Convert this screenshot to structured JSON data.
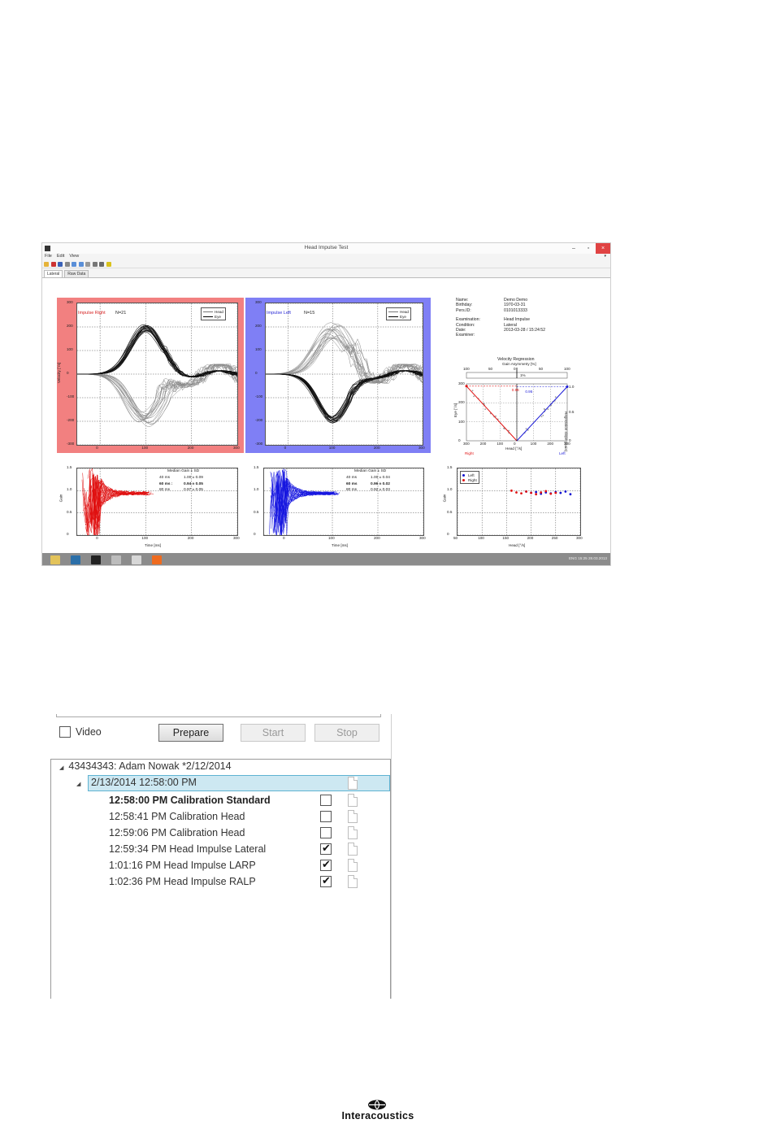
{
  "window": {
    "title": "Head Impulse Test",
    "menu": [
      "File",
      "Edit",
      "View"
    ],
    "tabs": [
      "Lateral",
      "Raw Data"
    ],
    "controls": {
      "minimize": "–",
      "maximize": "▫",
      "close": "×"
    }
  },
  "patient_info": [
    {
      "label": "Name:",
      "value": "Demo Demo"
    },
    {
      "label": "Birthday:",
      "value": "1970-03-31"
    },
    {
      "label": "Pers.ID:",
      "value": "0101013333"
    },
    {
      "label": "Examination:",
      "value": "Head Impulse"
    },
    {
      "label": "Condition:",
      "value": "Lateral"
    },
    {
      "label": "Date:",
      "value": "2013-03-28 / 15:24:52"
    },
    {
      "label": "Examiner:",
      "value": ""
    }
  ],
  "impulse_right": {
    "title": "Impulse Right",
    "count": "N=21",
    "ylabel": "Velocity [°/s]",
    "yticks": [
      "300",
      "200",
      "100",
      "0",
      "-100",
      "-200",
      "-300"
    ],
    "xticks": [
      "0",
      "100",
      "200",
      "300"
    ],
    "legend": [
      "Head",
      "Eye"
    ],
    "color": "#f28080"
  },
  "impulse_left": {
    "title": "Impulse Left",
    "count": "N=15",
    "yticks": [
      "300",
      "200",
      "100",
      "0",
      "-100",
      "-200",
      "-300"
    ],
    "xticks": [
      "0",
      "100",
      "200",
      "300"
    ],
    "legend": [
      "Head",
      "Eye"
    ],
    "color": "#7f7ff5"
  },
  "gain_right": {
    "ylabel": "Gain",
    "xlabel": "Time [ms]",
    "yticks": [
      "1.5",
      "1.0",
      "0.5",
      "0"
    ],
    "xticks": [
      "0",
      "100",
      "200",
      "300"
    ],
    "stats_header": "Median Gain ± SD",
    "stats": [
      {
        "k": "40 ms",
        "v": "1.00 ± 0.09",
        "bold": false
      },
      {
        "k": "60 ms :",
        "v": "0.94 ± 0.05",
        "bold": true
      },
      {
        "k": "80 ms",
        "v": "0.97 ± 0.05",
        "bold": false
      }
    ]
  },
  "gain_left": {
    "xlabel": "Time [ms]",
    "yticks": [
      "1.5",
      "1.0",
      "0.5",
      "0"
    ],
    "xticks": [
      "0",
      "100",
      "200",
      "300"
    ],
    "stats_header": "Median Gain ± SD",
    "stats": [
      {
        "k": "40 ms",
        "v": "1.00 ± 0.04",
        "bold": false
      },
      {
        "k": "60 ms",
        "v": "0.96 ± 0.02",
        "bold": true
      },
      {
        "k": "80 ms",
        "v": "0.92 ± 0.03",
        "bold": false
      }
    ]
  },
  "velocity_regression": {
    "title": "Velocity Regression",
    "top_axis_label": "Gain Asymmetry [%]",
    "top_ticks": [
      "100",
      "50",
      "0",
      "50",
      "100"
    ],
    "asym_value": "1%",
    "ylabel": "Eye [°/s]",
    "yticks": [
      "300",
      "200",
      "100",
      "0"
    ],
    "right_label": "Regression slope (Gain)",
    "right_ticks": [
      "1.0",
      "0.5",
      "0"
    ],
    "xlabel": "Head [°/s]",
    "xticks": [
      "300",
      "200",
      "100",
      "0",
      "100",
      "200",
      "300"
    ],
    "gain_right_value": "0.96",
    "gain_left_value": "0.95",
    "side_right": "Right",
    "side_left": "Left"
  },
  "gain_scatter": {
    "ylabel": "Gain",
    "xlabel": "Head [°/s]",
    "yticks": [
      "1.5",
      "1.0",
      "0.5",
      "0"
    ],
    "xticks": [
      "50",
      "100",
      "150",
      "200",
      "250",
      "300"
    ],
    "legend": [
      "Left",
      "Right"
    ]
  },
  "taskbar": {
    "tray": "ENG",
    "time": "15:25",
    "date": "28.03.2013"
  },
  "recording_panel": {
    "video_label": "Video",
    "prepare": "Prepare",
    "start": "Start",
    "stop": "Stop",
    "patient": "43434343: Adam Nowak *2/12/2014",
    "session": "2/13/2014 12:58:00 PM",
    "records": [
      {
        "label": "12:58:00 PM Calibration Standard",
        "checked": false,
        "bold": true
      },
      {
        "label": "12:58:41 PM Calibration Head",
        "checked": false,
        "bold": false
      },
      {
        "label": "12:59:06 PM Calibration Head",
        "checked": false,
        "bold": false
      },
      {
        "label": "12:59:34 PM Head Impulse Lateral",
        "checked": true,
        "bold": false
      },
      {
        "label": "1:01:16 PM Head Impulse LARP",
        "checked": true,
        "bold": false
      },
      {
        "label": "1:02:36 PM Head Impulse RALP",
        "checked": true,
        "bold": false
      }
    ]
  },
  "brand": {
    "name": "Interacoustics"
  },
  "chart_data": [
    {
      "type": "line",
      "title": "Impulse Right",
      "ylabel": "Velocity [°/s]",
      "xlim": [
        -50,
        300
      ],
      "ylim": [
        -300,
        300
      ],
      "series": [
        {
          "name": "Head",
          "x": [
            -50,
            0,
            50,
            100,
            150,
            200,
            250,
            300
          ],
          "values": [
            0,
            5,
            120,
            200,
            100,
            -30,
            -50,
            -40
          ]
        },
        {
          "name": "Eye",
          "x": [
            -50,
            0,
            50,
            100,
            150,
            200,
            250,
            300
          ],
          "values": [
            0,
            0,
            -70,
            -190,
            -100,
            20,
            30,
            0
          ]
        }
      ]
    },
    {
      "type": "line",
      "title": "Impulse Left",
      "xlim": [
        -50,
        300
      ],
      "ylim": [
        -300,
        300
      ],
      "series": [
        {
          "name": "Head",
          "x": [
            -50,
            0,
            50,
            100,
            150,
            200,
            250,
            300
          ],
          "values": [
            0,
            -5,
            -120,
            -210,
            -120,
            20,
            30,
            20
          ]
        },
        {
          "name": "Eye",
          "x": [
            -50,
            0,
            50,
            100,
            150,
            200,
            250,
            300
          ],
          "values": [
            0,
            0,
            120,
            230,
            120,
            -10,
            -20,
            0
          ]
        }
      ]
    },
    {
      "type": "line",
      "xlabel": "Time [ms]",
      "ylabel": "Gain",
      "xlim": [
        -50,
        300
      ],
      "ylim": [
        0,
        1.5
      ],
      "stats": {
        "40 ms": "1.00 ± 0.09",
        "60 ms": "0.94 ± 0.05",
        "80 ms": "0.97 ± 0.05"
      }
    },
    {
      "type": "line",
      "xlabel": "Time [ms]",
      "xlim": [
        -50,
        300
      ],
      "ylim": [
        0,
        1.5
      ],
      "stats": {
        "40 ms": "1.00 ± 0.04",
        "60 ms": "0.96 ± 0.02",
        "80 ms": "0.92 ± 0.03"
      }
    },
    {
      "type": "line",
      "title": "Velocity Regression",
      "xlabel": "Head [°/s]",
      "ylabel": "Eye [°/s]",
      "xlim": [
        -300,
        300
      ],
      "ylim": [
        0,
        300
      ],
      "series": [
        {
          "name": "Right",
          "slope": 0.96
        },
        {
          "name": "Left",
          "slope": 0.95
        }
      ],
      "asymmetry": "1%"
    },
    {
      "type": "scatter",
      "xlabel": "Head [°/s]",
      "ylabel": "Gain",
      "xlim": [
        50,
        300
      ],
      "ylim": [
        0,
        1.5
      ],
      "series": [
        {
          "name": "Left",
          "x": [
            190,
            200,
            210,
            220,
            230,
            240,
            250,
            260,
            270,
            280
          ],
          "values": [
            0.98,
            0.95,
            0.97,
            0.93,
            0.96,
            0.94,
            0.97,
            0.95,
            0.98,
            0.92
          ]
        },
        {
          "name": "Right",
          "x": [
            160,
            170,
            180,
            190,
            200,
            210,
            220,
            230,
            240,
            250
          ],
          "values": [
            1.0,
            0.96,
            0.94,
            0.98,
            0.95,
            0.92,
            0.96,
            0.99,
            0.93,
            0.95
          ]
        }
      ]
    }
  ]
}
